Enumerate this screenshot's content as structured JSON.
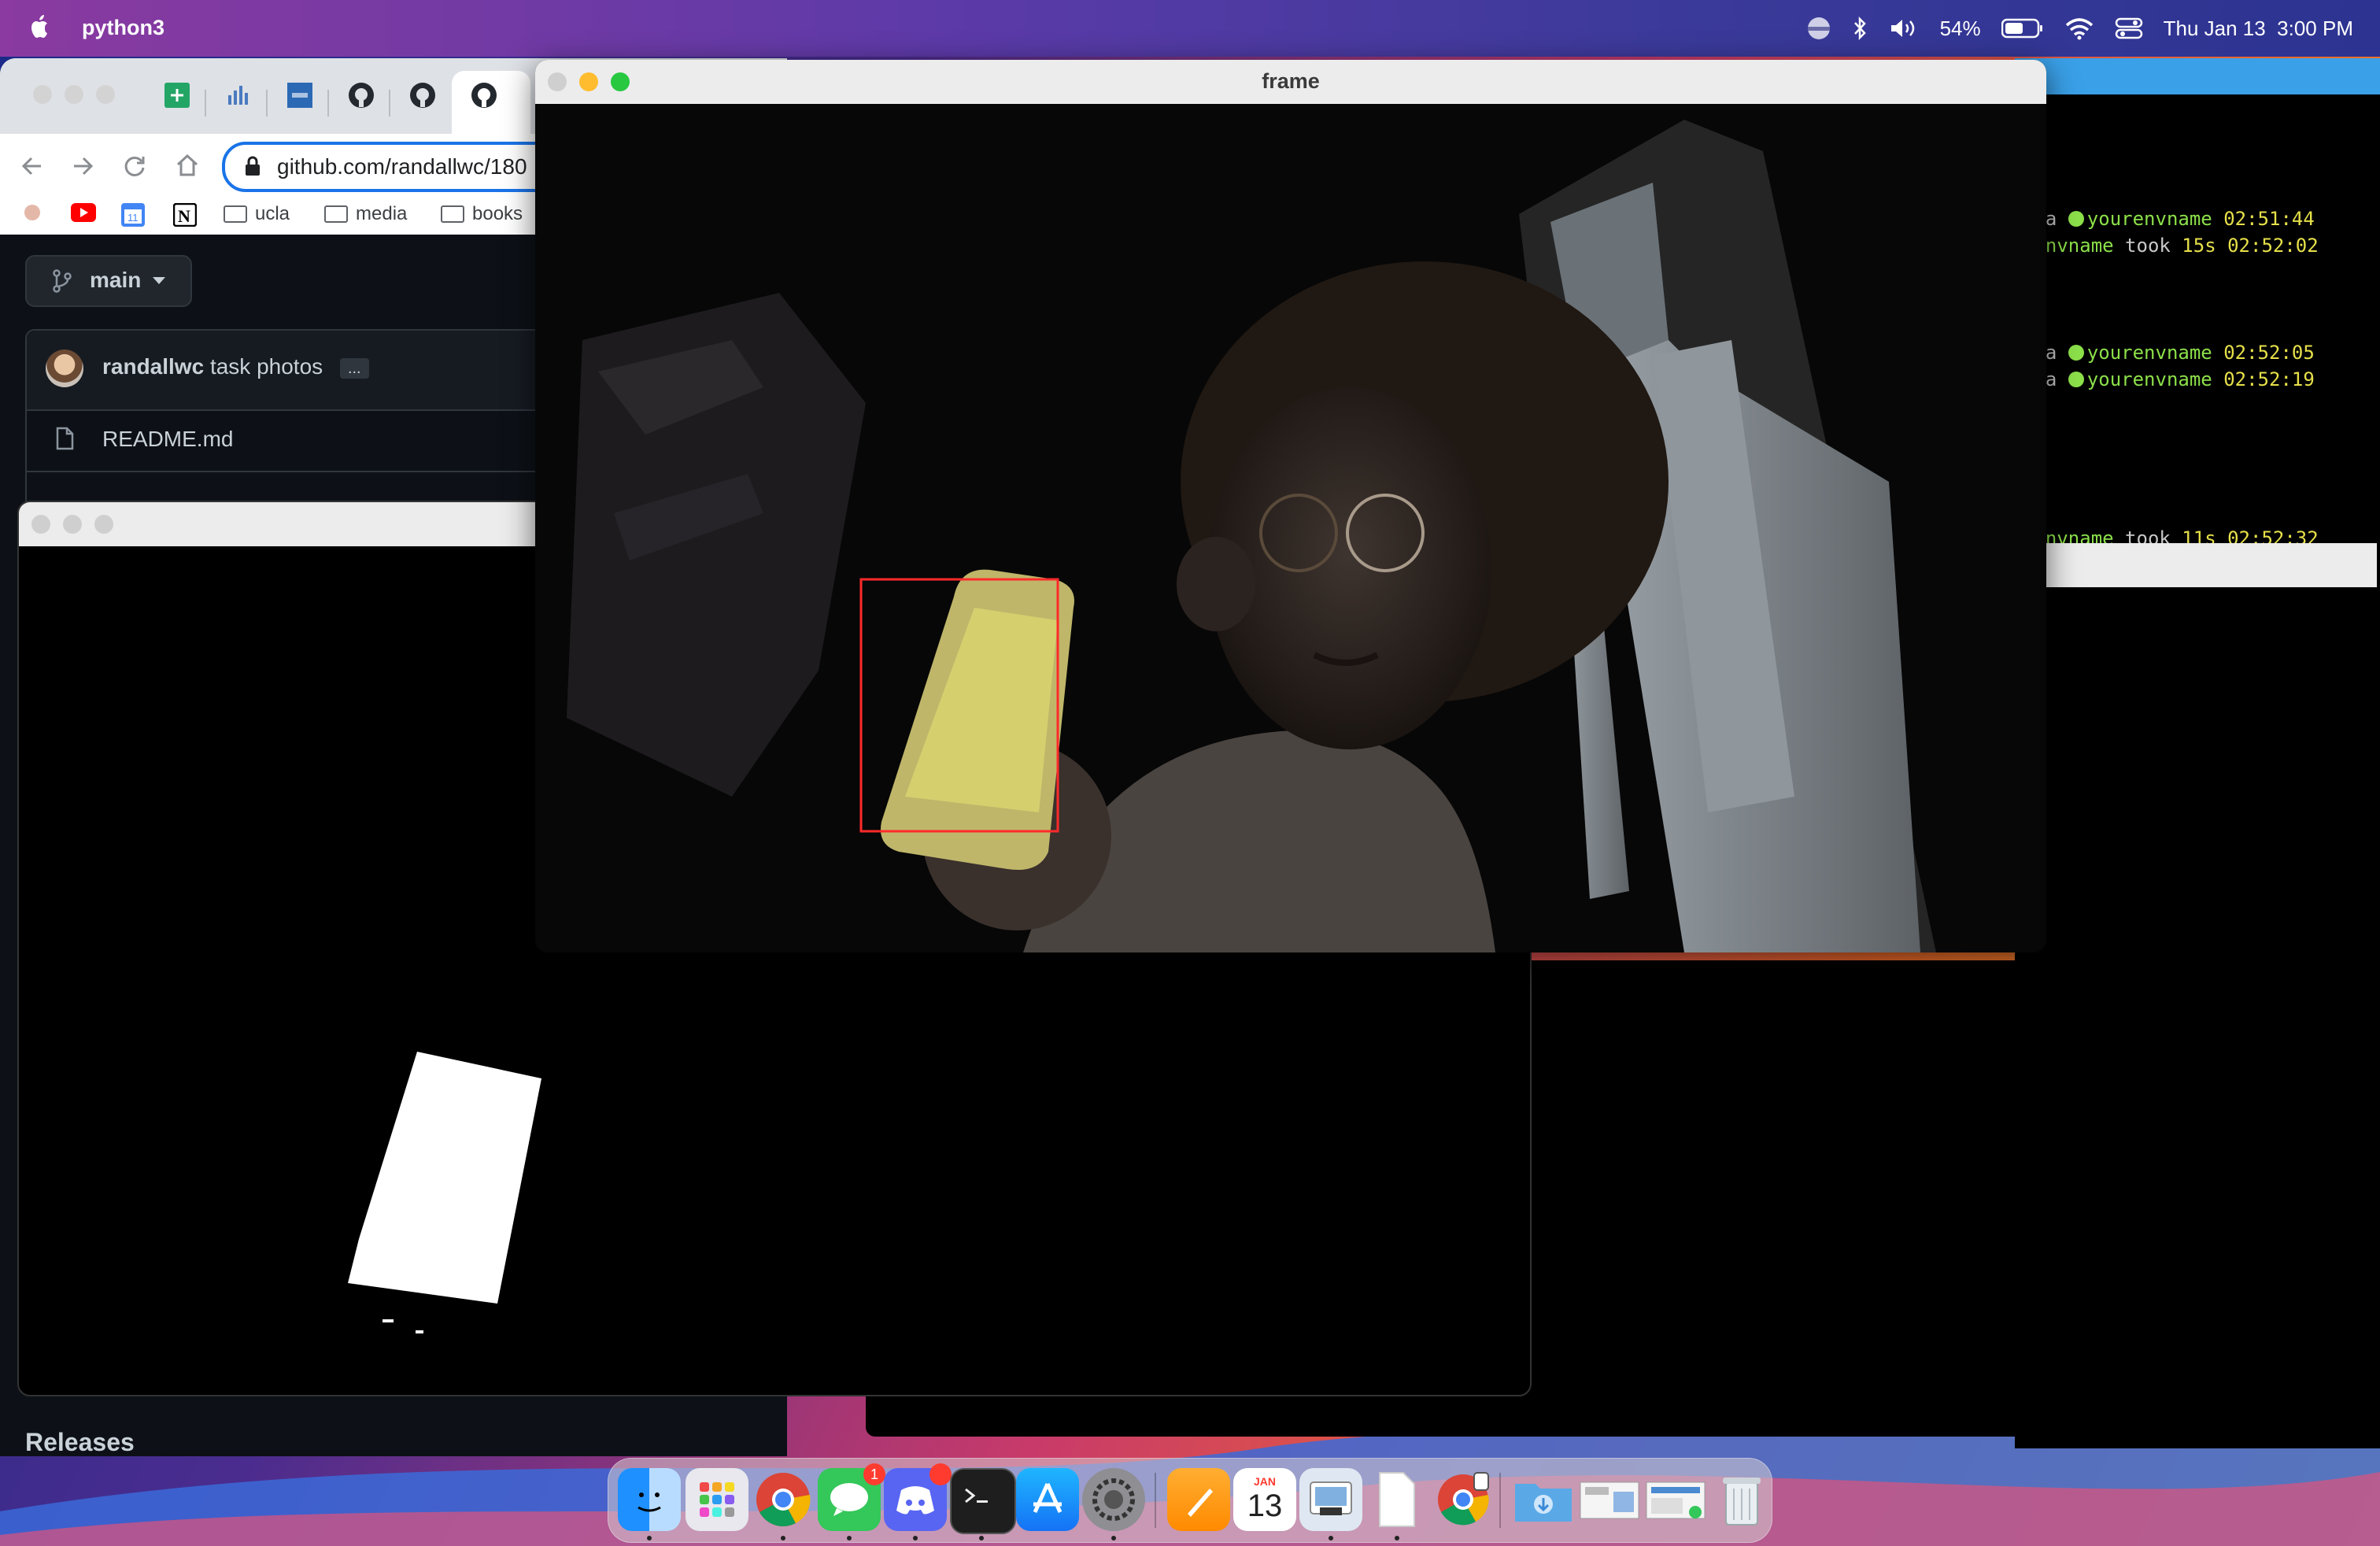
{
  "menubar": {
    "app_name": "python3",
    "battery": "54%",
    "datetime": "Thu Jan 13  3:00 PM"
  },
  "browser": {
    "url": "github.com/randallwc/180",
    "bookmarks": [
      "ucla",
      "media",
      "books"
    ],
    "branch": "main",
    "commit_author": "randallwc",
    "commit_message": "task photos",
    "commit_more": "...",
    "file": "README.md",
    "releases_heading": "Releases"
  },
  "terminal": {
    "lines": [
      {
        "prefix": "via ",
        "env": "yourenvname",
        "time": "02:51:44"
      },
      {
        "prefix": "renvname",
        "took": "took",
        "dur": "15s",
        "time": "02:52:02"
      },
      {
        "prefix": "via ",
        "env": "yourenvname",
        "time": "02:52:05"
      },
      {
        "prefix": "via ",
        "env": "yourenvname",
        "time": "02:52:19"
      },
      {
        "prefix": "renvname",
        "took": "took",
        "dur": "11s",
        "time": "02:52:32"
      }
    ]
  },
  "frame_window": {
    "title": "frame"
  },
  "dock": {
    "calendar_month": "JAN",
    "calendar_day": "13",
    "messages_badge": "1",
    "apps": [
      "finder-icon",
      "launchpad-icon",
      "chrome-icon",
      "messages-icon",
      "discord-icon",
      "terminal-icon",
      "app-store-icon",
      "system-preferences-icon",
      "pages-icon",
      "calendar-icon",
      "preview-icon",
      "textedit-icon",
      "chrome-app-icon",
      "downloads-folder-icon",
      "window-thumb-1-icon",
      "window-thumb-2-icon",
      "trash-icon"
    ]
  },
  "colors": {
    "detection_box": "#ff2a2a",
    "github_bg": "#0d1117",
    "terminal_green": "#8ce04a",
    "terminal_yellow": "#e6e04a"
  }
}
